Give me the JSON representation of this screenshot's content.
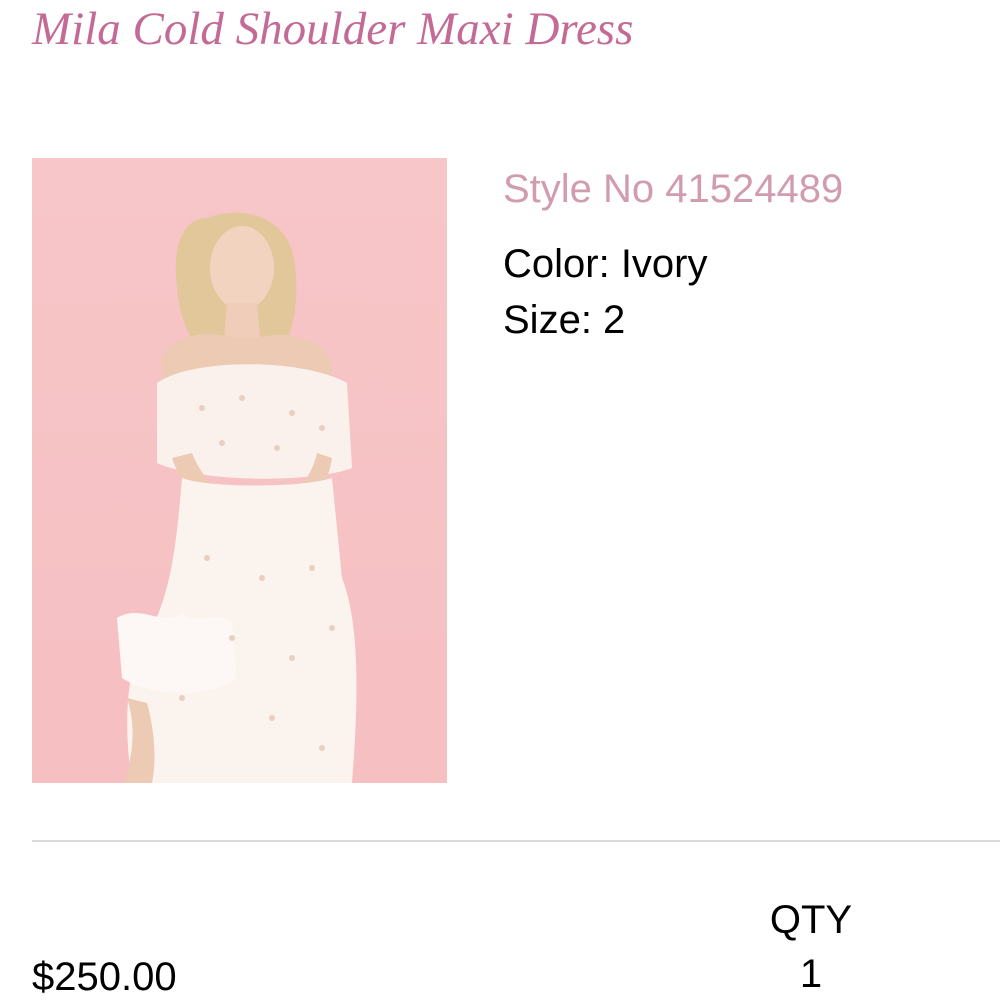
{
  "product": {
    "title": "Mila Cold Shoulder Maxi Dress",
    "style_no": "Style No 41524489",
    "color": "Color: Ivory",
    "size": "Size: 2",
    "price": "$250.00"
  },
  "quantity": {
    "label": "QTY",
    "value": "1"
  },
  "colors": {
    "title": "#c36b95",
    "style_no": "#d29cb0",
    "image_background": "#f7c3c5",
    "dress": "#fbf3ee",
    "divider": "#d9d9d9"
  }
}
